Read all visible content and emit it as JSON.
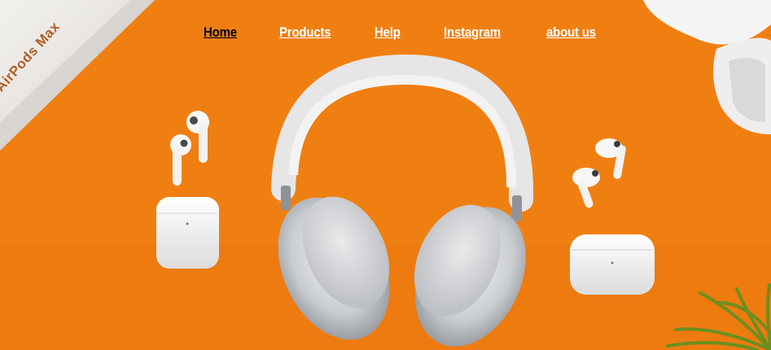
{
  "nav": {
    "items": [
      {
        "label": "Home",
        "active": true
      },
      {
        "label": "Products",
        "active": false
      },
      {
        "label": "Help",
        "active": false
      },
      {
        "label": "Instagram",
        "active": false
      },
      {
        "label": "about us",
        "active": false
      }
    ]
  },
  "hero": {
    "box_label": "AirPods Max",
    "background_color": "#f07f12"
  },
  "colors": {
    "nav_text": "#ffffff",
    "nav_active": "#000000"
  }
}
